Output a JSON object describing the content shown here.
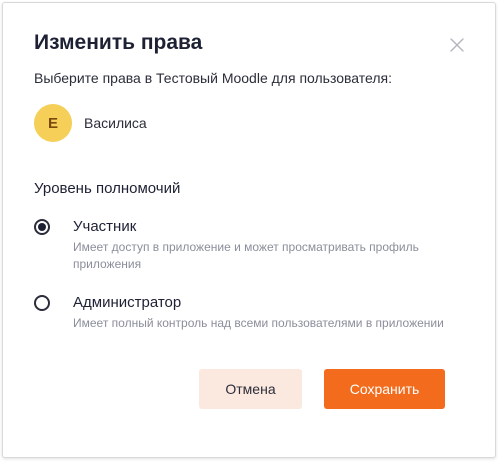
{
  "dialog": {
    "title": "Изменить права",
    "close_icon": "close-icon",
    "subtitle": "Выберите права в Тестовый Moodle для пользователя:"
  },
  "user": {
    "initial": "Е",
    "name": "Василиса",
    "avatar_color": "#f5cf57"
  },
  "permissions": {
    "heading": "Уровень полномочий",
    "selected": "participant",
    "options": [
      {
        "id": "participant",
        "label": "Участник",
        "description": "Имеет доступ в приложение и может просматривать профиль приложения",
        "checked": true
      },
      {
        "id": "administrator",
        "label": "Администратор",
        "description": "Имеет полный контроль над всеми пользователями в приложении",
        "checked": false
      }
    ]
  },
  "actions": {
    "cancel_label": "Отмена",
    "save_label": "Сохранить",
    "accent_color": "#f36b1c",
    "cancel_bg_color": "#fbe8df"
  }
}
